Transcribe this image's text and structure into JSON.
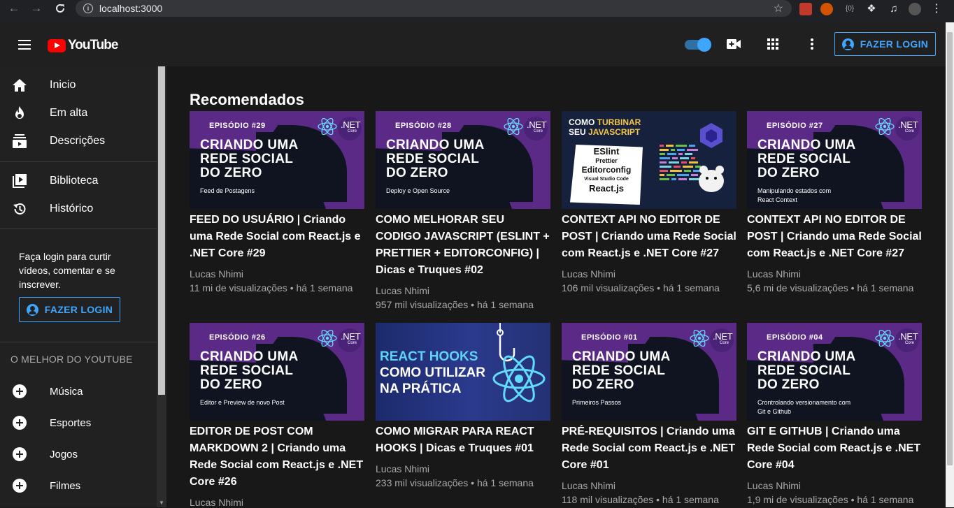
{
  "browser": {
    "url": "localhost:3000"
  },
  "masthead": {
    "logo_text": "YouTube",
    "login_label": "FAZER LOGIN"
  },
  "sidebar": {
    "items": [
      {
        "label": "Inicio",
        "icon": "home-icon"
      },
      {
        "label": "Em alta",
        "icon": "fire-icon"
      },
      {
        "label": "Descrições",
        "icon": "subscriptions-icon"
      },
      {
        "label": "Biblioteca",
        "icon": "library-icon"
      },
      {
        "label": "Histórico",
        "icon": "history-icon"
      }
    ],
    "login_prompt": "Faça login para curtir vídeos, comentar e se inscrever.",
    "login_label": "FAZER LOGIN",
    "section_title": "O MELHOR DO YOUTUBE",
    "best_of": [
      {
        "label": "Música",
        "icon": "plus-circle-icon"
      },
      {
        "label": "Esportes",
        "icon": "plus-circle-icon"
      },
      {
        "label": "Jogos",
        "icon": "plus-circle-icon"
      },
      {
        "label": "Filmes",
        "icon": "plus-circle-icon"
      }
    ]
  },
  "main": {
    "section_title": "Recomendados",
    "videos": [
      {
        "title": "FEED DO USUÁRIO | Criando uma Rede Social com React.js e .NET Core #29",
        "channel": "Lucas Nhimi",
        "meta": "11 mi de visualizações • há 1 semana",
        "thumb": {
          "kind": "episode",
          "badge": "EPISÓDIO #29",
          "headline": [
            "CRIANDO UMA",
            "REDE SOCIAL",
            "DO ZERO"
          ],
          "sub": [
            "Feed de Postagens"
          ],
          "net": ".NET",
          "net_core": "Core"
        }
      },
      {
        "title": "COMO MELHORAR SEU CODIGO JAVASCRIPT (ESLINT + PRETTIER + EDITORCONFIG) | Dicas e Truques #02",
        "channel": "Lucas Nhimi",
        "meta": "957 mil visualizações • há 1 semana",
        "thumb": {
          "kind": "episode",
          "badge": "EPISÓDIO #28",
          "headline": [
            "CRIANDO UMA",
            "REDE SOCIAL",
            "DO ZERO"
          ],
          "sub": [
            "Deploy e Open Source"
          ],
          "net": ".NET",
          "net_core": "Core"
        }
      },
      {
        "title": "CONTEXT API NO EDITOR DE POST | Criando uma Rede Social com React.js e .NET Core #27",
        "channel": "Lucas Nhimi",
        "meta": "106 mil visualizações • há 1 semana",
        "thumb": {
          "kind": "turbo",
          "line1_a": "COMO ",
          "line1_b": "TURBINAR",
          "line2_a": "SEU ",
          "line2_b": "JAVASCRIPT",
          "labels": [
            "ESlint",
            "Prettier",
            "Editorconfig",
            "Visual Studio Code",
            "React.js"
          ]
        }
      },
      {
        "title": "CONTEXT API NO EDITOR DE POST | Criando uma Rede Social com React.js e .NET Core #27",
        "channel": "Lucas Nhimi",
        "meta": "5,6 mi de visualizações • há 1 semana",
        "thumb": {
          "kind": "episode",
          "badge": "EPISÓDIO #27",
          "headline": [
            "CRIANDO UMA",
            "REDE SOCIAL",
            "DO ZERO"
          ],
          "sub": [
            "Manipulando estados com",
            "React Context"
          ],
          "net": ".NET",
          "net_core": "Core"
        }
      },
      {
        "title": "EDITOR DE POST COM MARKDOWN 2 | Criando uma Rede Social com React.js e .NET Core #26",
        "channel": "Lucas Nhimi",
        "meta": "",
        "thumb": {
          "kind": "episode",
          "badge": "EPISÓDIO #26",
          "headline": [
            "CRIANDO UMA",
            "REDE SOCIAL",
            "DO ZERO"
          ],
          "sub": [
            "Editor e Preview de novo Post"
          ],
          "net": ".NET",
          "net_core": "Core"
        }
      },
      {
        "title": "COMO MIGRAR PARA REACT HOOKS | Dicas e Truques #01",
        "channel": "Lucas Nhimi",
        "meta": "233 mil visualizações • há 1 semana",
        "thumb": {
          "kind": "hooks",
          "lines": [
            "REACT HOOKS",
            "COMO UTILIZAR",
            "NA PRÁTICA"
          ]
        }
      },
      {
        "title": "PRÉ-REQUISITOS | Criando uma Rede Social com React.js e .NET Core #01",
        "channel": "Lucas Nhimi",
        "meta": "118 mil visualizações • há 1 semana",
        "thumb": {
          "kind": "episode",
          "badge": "EPISÓDIO #01",
          "headline": [
            "CRIANDO UMA",
            "REDE SOCIAL",
            "DO ZERO"
          ],
          "sub": [
            "Primeiros Passos"
          ],
          "net": ".NET",
          "net_core": "Core"
        }
      },
      {
        "title": "GIT E GITHUB | Criando uma Rede Social com React.js e .NET Core #04",
        "channel": "Lucas Nhimi",
        "meta": "1,9 mi de visualizações • há 1 semana",
        "thumb": {
          "kind": "episode",
          "badge": "EPISÓDIO #04",
          "headline": [
            "CRIANDO UMA",
            "REDE SOCIAL",
            "DO ZERO"
          ],
          "sub": [
            "Crontrolando versionamento com",
            "Git e Github"
          ],
          "net": ".NET",
          "net_core": "Core"
        }
      }
    ]
  }
}
